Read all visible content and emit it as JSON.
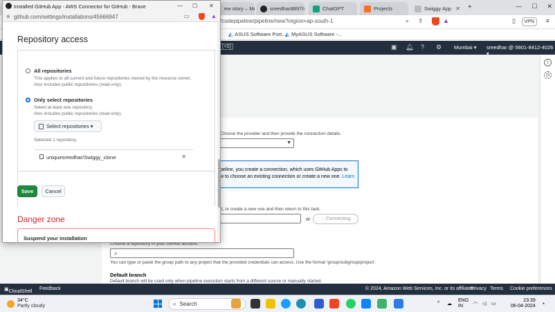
{
  "main_browser": {
    "tabs": [
      {
        "label": "ew story – Medi",
        "active": false
      },
      {
        "label": "sreedhar8897/swi",
        "active": false
      },
      {
        "label": "ChatGPT",
        "active": false
      },
      {
        "label": "Projects",
        "active": false
      },
      {
        "label": "Swiggy App",
        "active": false
      }
    ],
    "url": "/codepipeline/pipeline/new?region=ap-south-1",
    "vpn_label": "VPN",
    "bookmarks": [
      "ASUS Software Port...",
      "MyASUS Software -..."
    ]
  },
  "aws_header": {
    "shortcut": "[+S]",
    "region": "Mumbai ▾",
    "account": "sreedhar @ 5901-8412-4026 ▾"
  },
  "aws_content": {
    "provider_help": "Choose the provider and then provide the connection details.",
    "info_line1": "peline, you create a connection, which uses GitHub Apps to",
    "info_line2": "w to choose an existing connection or create a new one.",
    "info_learn": "Learn",
    "connection_help": "d, or create a new one and then return to this task.",
    "or_label": "or",
    "connecting_label": "Connecting",
    "repo_help": "Choose a repository in your GitHub account.",
    "group_help": "You can type or paste the group path to any project that the provided credentials can access. Use the format 'group/subgroup/project'.",
    "default_branch_label": "Default branch",
    "default_branch_help": "Default branch will be used only when pipeline execution starts from a different source or manually started."
  },
  "aws_footer": {
    "cloudshell": "CloudShell",
    "feedback": "Feedback",
    "copyright": "© 2024, Amazon Web Services, Inc. or its affiliates.",
    "privacy": "Privacy",
    "terms": "Terms",
    "cookie": "Cookie preferences"
  },
  "popup": {
    "title": "Installed GitHub App - AWS Connector for GitHub - Brave",
    "url": "github.com/settings/installations/45666947",
    "heading": "Repository access",
    "all_repos": {
      "label": "All repositories",
      "desc1": "This applies to all current and future repositories owned by the resource owner.",
      "desc2": "Also includes public repositories (read-only)."
    },
    "select_repos": {
      "label": "Only select repositories",
      "desc1": "Select at least one repository.",
      "desc2": "Also includes public repositories (read-only)."
    },
    "select_button": "Select repositories ▾",
    "selected_count": "Selected 1 repository.",
    "repo_owner": "uniquesreedhar/",
    "repo_name": "Swiggy_clone",
    "remove": "✕",
    "save": "Save",
    "cancel": "Cancel",
    "danger_heading": "Danger zone",
    "danger_item": "Suspend your installation"
  },
  "taskbar": {
    "temp": "34°C",
    "weather": "Partly cloudy",
    "search": "Search",
    "lang1": "ENG",
    "lang2": "IN",
    "time": "23:39",
    "date": "06-04-2024"
  }
}
